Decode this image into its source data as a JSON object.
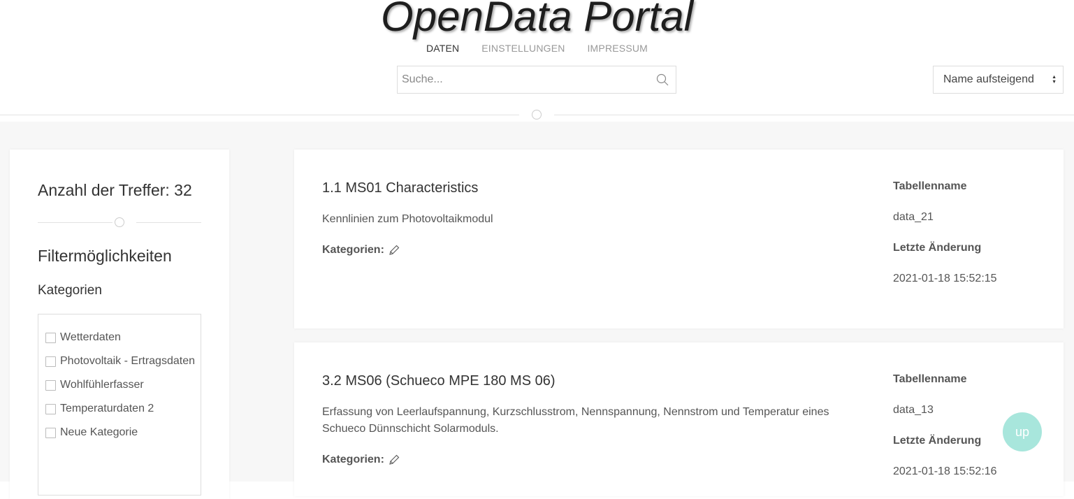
{
  "header": {
    "logo": "OpenData Portal",
    "nav": [
      {
        "label": "DATEN",
        "active": true
      },
      {
        "label": "EINSTELLUNGEN",
        "active": false
      },
      {
        "label": "IMPRESSUM",
        "active": false
      }
    ],
    "search_placeholder": "Suche...",
    "sort_selected": "Name aufsteigend"
  },
  "sidebar": {
    "hits_label": "Anzahl der Treffer: 32",
    "filter_title": "Filtermöglichkeiten",
    "categories_title": "Kategorien",
    "categories": [
      "Wetterdaten",
      "Photovoltaik - Ertragsdaten",
      "Wohlfühlerfasser",
      "Temperaturdaten 2",
      "Neue Kategorie"
    ]
  },
  "cards": [
    {
      "title": "1.1 MS01 Characteristics",
      "description": "Kennlinien zum Photovoltaikmodul",
      "categories_label": "Kategorien:",
      "table_label": "Tabellenname",
      "table_name": "data_21",
      "changed_label": "Letzte Änderung",
      "changed": "2021-01-18 15:52:15"
    },
    {
      "title": "3.2 MS06 (Schueco MPE 180 MS 06)",
      "description": "Erfassung von Leerlaufspannung, Kurzschlusstrom, Nennspannung, Nennstrom und Temperatur eines Schueco Dünnschicht Solarmoduls.",
      "categories_label": "Kategorien:",
      "table_label": "Tabellenname",
      "table_name": "data_13",
      "changed_label": "Letzte Änderung",
      "changed": "2021-01-18 15:52:16"
    }
  ],
  "up_button": "up",
  "colors": {
    "accent": "#a8e6dc",
    "background": "#f7f7f7"
  }
}
